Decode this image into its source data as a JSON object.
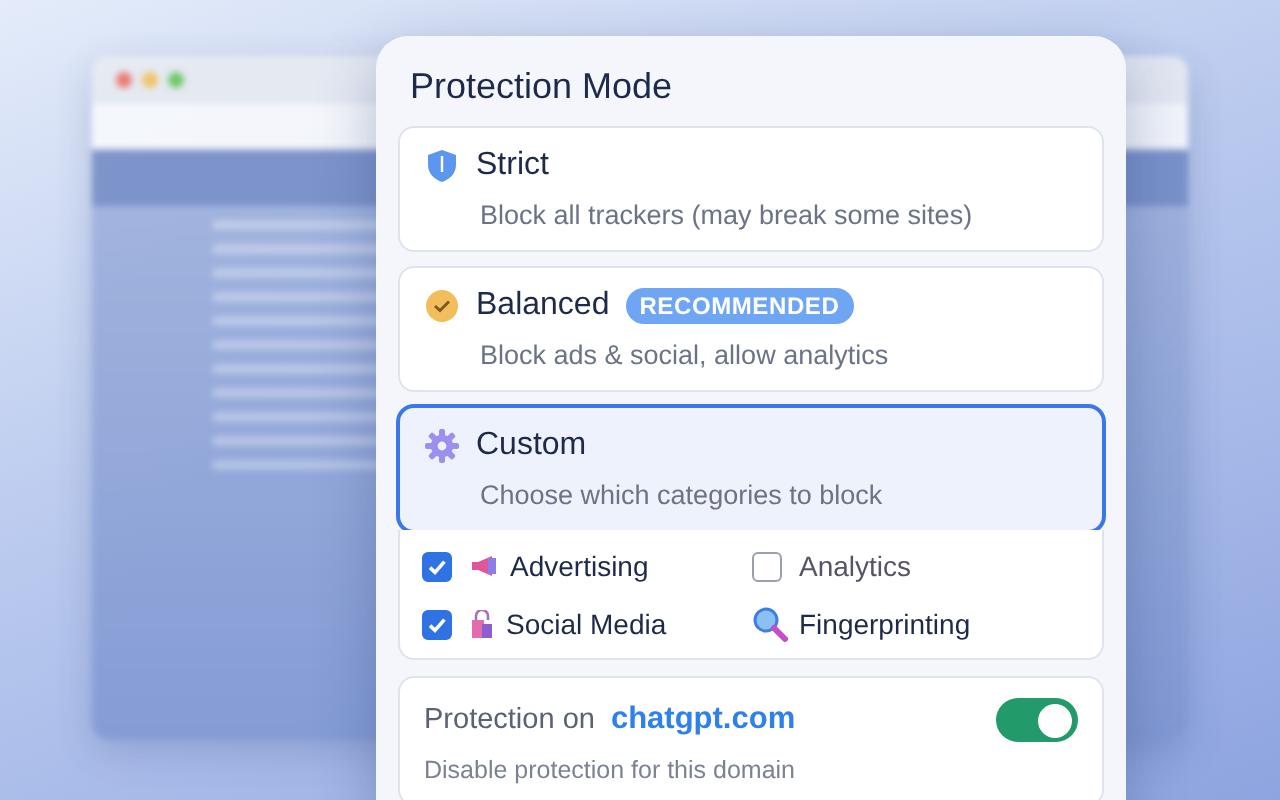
{
  "panel": {
    "title": "Protection Mode"
  },
  "modes": [
    {
      "kind": "shield",
      "title": "Strict",
      "description": "Block all trackers (may break some sites)",
      "selected": false
    },
    {
      "kind": "check",
      "title": "Balanced",
      "badge": "RECOMMENDED",
      "description": "Block ads & social, allow analytics",
      "selected": false
    },
    {
      "kind": "gear",
      "title": "Custom",
      "description": "Choose which categories to block",
      "selected": true
    }
  ],
  "categories": [
    {
      "kind": "checkbox-icon",
      "label": "Advertising",
      "checked": true
    },
    {
      "kind": "checkbox",
      "label": "Analytics",
      "checked": false
    },
    {
      "kind": "checkbox-icon",
      "label": "Social Media",
      "checked": true
    },
    {
      "kind": "icon",
      "label": "Fingerprinting"
    }
  ],
  "domain": {
    "label": "Protection on",
    "site": "chatgpt.com",
    "hint": "Disable protection for this domain",
    "on": true
  }
}
